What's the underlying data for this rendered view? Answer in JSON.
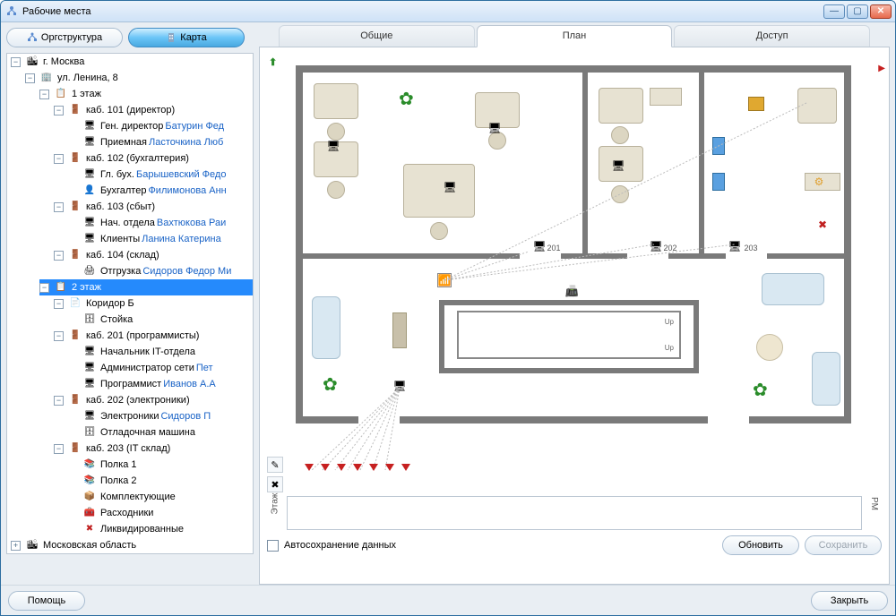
{
  "window": {
    "title": "Рабочие места"
  },
  "sidebar_buttons": {
    "org": "Оргструктура",
    "map": "Карта"
  },
  "tree": {
    "root1": "г. Москва",
    "addr1": "ул. Ленина, 8",
    "floor1": "1 этаж",
    "cab101": "каб. 101 (директор)",
    "cab101a_pre": "Ген. директор ",
    "cab101a_link": "Батурин Фед",
    "cab101b_pre": "Приемная ",
    "cab101b_link": "Ласточкина Люб",
    "cab102": "каб. 102 (бухгалтерия)",
    "cab102a_pre": "Гл. бух. ",
    "cab102a_link": "Барышевский Федо",
    "cab102b_pre": "Бухгалтер ",
    "cab102b_link": "Филимонова Анн",
    "cab103": "каб. 103 (сбыт)",
    "cab103a_pre": "Нач. отдела ",
    "cab103a_link": "Вахтюкова Раи",
    "cab103b_pre": "Клиенты ",
    "cab103b_link": "Ланина Катерина",
    "cab104": "каб. 104 (склад)",
    "cab104a_pre": "Отгрузка ",
    "cab104a_link": "Сидоров Федор Ми",
    "floor2": "2 этаж",
    "corB": "Коридор Б",
    "stoika": "Стойка",
    "cab201": "каб. 201 (программисты)",
    "cab201a": "Начальник IT-отдела",
    "cab201b_pre": "Администратор сети  ",
    "cab201b_link": "Пет",
    "cab201c_pre": "Программист ",
    "cab201c_link": "Иванов А.А",
    "cab202": "каб. 202 (электроники)",
    "cab202a_pre": "Электроники ",
    "cab202a_link": "Сидоров П",
    "cab202b": "Отладочная машина",
    "cab203": "каб. 203 (IT склад)",
    "shelf1": "Полка 1",
    "shelf2": "Полка 2",
    "kompl": "Комплектующие",
    "rashod": "Расходники",
    "likvid": "Ликвидированные",
    "root2": "Московская область"
  },
  "tabs": {
    "general": "Общие",
    "plan": "План",
    "access": "Доступ"
  },
  "plan": {
    "room201": "201",
    "room202": "202",
    "room203": "203",
    "up": "Up",
    "vlabel_left": "Этаж",
    "vlabel_right": "РМ"
  },
  "footer": {
    "autosave": "Автосохранение данных",
    "refresh": "Обновить",
    "save": "Сохранить"
  },
  "bottom": {
    "help": "Помощь",
    "close": "Закрыть"
  }
}
